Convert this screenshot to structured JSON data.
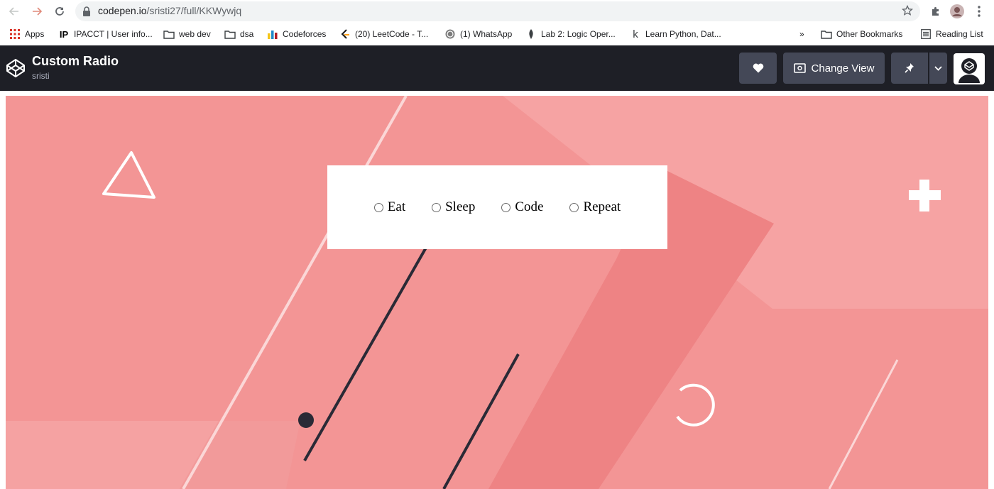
{
  "browser": {
    "url_host": "codepen.io",
    "url_path": "/sristi27/full/KKWywjq",
    "bookmarks": [
      {
        "label": "Apps",
        "icon": "apps-grid-icon"
      },
      {
        "label": "IPACCT | User info...",
        "icon": "ipacct-icon"
      },
      {
        "label": "web dev",
        "icon": "folder-icon"
      },
      {
        "label": "dsa",
        "icon": "folder-icon"
      },
      {
        "label": "Codeforces",
        "icon": "codeforces-icon"
      },
      {
        "label": "(20) LeetCode - T...",
        "icon": "leetcode-icon"
      },
      {
        "label": "(1) WhatsApp",
        "icon": "whatsapp-icon"
      },
      {
        "label": "Lab 2: Logic Oper...",
        "icon": "lab-icon"
      },
      {
        "label": "Learn Python, Dat...",
        "icon": "kaggle-icon"
      }
    ],
    "overflow_label": "»",
    "other_bookmarks": "Other Bookmarks",
    "reading_list": "Reading List"
  },
  "codepen": {
    "pen_title": "Custom Radio",
    "author": "sristi",
    "change_view_label": "Change View",
    "header_bg": "#1e1f26",
    "button_bg": "#444857"
  },
  "preview": {
    "background": "#f39595",
    "radio_options": [
      "Eat",
      "Sleep",
      "Code",
      "Repeat"
    ]
  }
}
